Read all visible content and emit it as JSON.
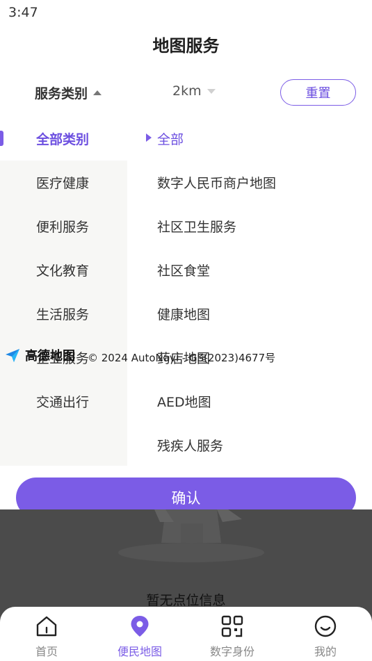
{
  "status_bar": {
    "time": "3:47"
  },
  "header": {
    "title": "地图服务"
  },
  "filters": {
    "category_label": "服务类别",
    "distance_label": "2km",
    "reset_label": "重置"
  },
  "categories": [
    {
      "label": "全部类别",
      "active": true
    },
    {
      "label": "医疗健康"
    },
    {
      "label": "便利服务"
    },
    {
      "label": "文化教育"
    },
    {
      "label": "生活服务"
    },
    {
      "label": "企业服务"
    },
    {
      "label": "交通出行"
    }
  ],
  "subcategories": [
    {
      "label": "全部",
      "active": true
    },
    {
      "label": "数字人民币商户地图"
    },
    {
      "label": "社区卫生服务"
    },
    {
      "label": "社区食堂"
    },
    {
      "label": "健康地图"
    },
    {
      "label": "药店地图"
    },
    {
      "label": "AED地图"
    },
    {
      "label": "残疾人服务"
    }
  ],
  "map": {
    "logo_text": "高德地图",
    "copyright": "© 2024 AutoNavi - GS(2023)4677号"
  },
  "confirm_label": "确认",
  "empty_state": {
    "text": "暂无点位信息"
  },
  "tabbar": {
    "items": [
      {
        "label": "首页",
        "icon": "home-icon"
      },
      {
        "label": "便民地图",
        "icon": "map-pin-icon",
        "active": true
      },
      {
        "label": "数字身份",
        "icon": "qr-code-icon"
      },
      {
        "label": "我的",
        "icon": "smile-icon"
      }
    ]
  },
  "colors": {
    "accent": "#7b5ce6",
    "overlay": "#4b4b4b",
    "panel": "#f7f7f5"
  }
}
